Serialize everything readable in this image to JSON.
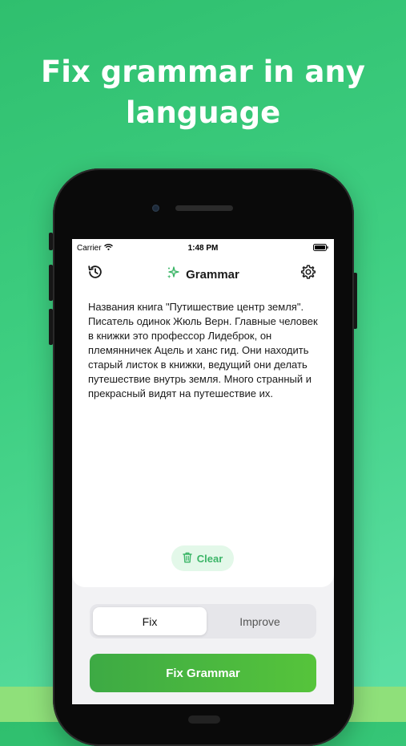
{
  "headline": {
    "line1": "Fix grammar in any",
    "line2": "language"
  },
  "status_bar": {
    "carrier": "Carrier",
    "time": "1:48 PM"
  },
  "nav": {
    "title": "Grammar",
    "history_icon": "history-icon",
    "sparkle_icon": "sparkle-icon",
    "settings_icon": "gear-icon"
  },
  "editor": {
    "text": "Названия книга \"Путишествие центр земля\". Писатель одинок Жюль Верн. Главные человек в книжки это профессор Лидеброк, он племянничек Ацель и ханс гид. Они находить старый листок в книжки, ведущий они делать путешествие внутрь земля. Много странный и прекрасный видят на путешествие их."
  },
  "clear_button": {
    "label": "Clear",
    "icon": "trash-icon"
  },
  "mode_segment": {
    "options": [
      "Fix",
      "Improve"
    ],
    "selected": "Fix"
  },
  "primary_button": {
    "label": "Fix Grammar"
  },
  "colors": {
    "background_start": "#2fbf6e",
    "background_end": "#5ee0a6",
    "accent_green": "#3bb567",
    "button_green": "#4bb840"
  }
}
